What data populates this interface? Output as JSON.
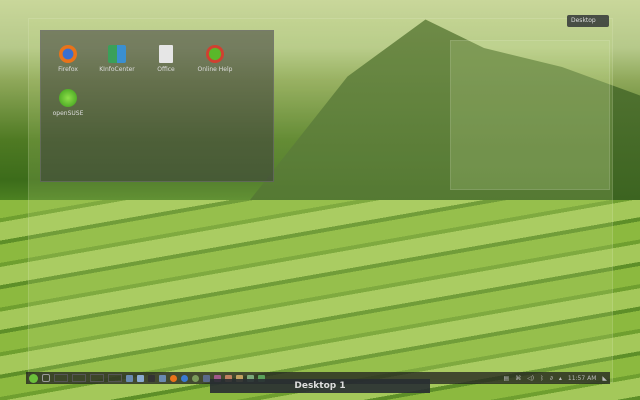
{
  "desktop_icons": [
    {
      "label": "Firefox",
      "color": "#e8731a"
    },
    {
      "label": "KInfoCenter",
      "color": "#3a8fd0"
    },
    {
      "label": "Office",
      "color": "#e0e0e0"
    },
    {
      "label": "Online Help",
      "color": "#d04030"
    },
    {
      "label": "openSUSE",
      "color": "#5ab82a"
    }
  ],
  "desktop_name": "Desktop 1",
  "corner_tooltip": "Desktop",
  "clock": "11:57 AM"
}
